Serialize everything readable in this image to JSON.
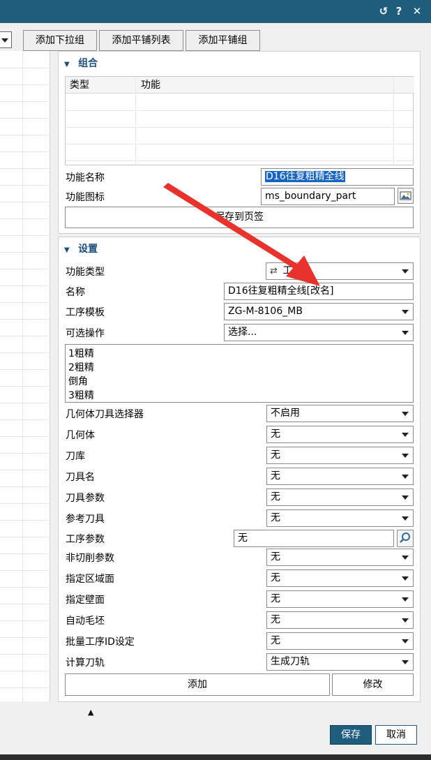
{
  "titlebar": {
    "icons": [
      "refresh-icon",
      "help-icon",
      "close-icon"
    ],
    "refresh_glyph": "↺",
    "help_glyph": "?",
    "close_glyph": "✕"
  },
  "toolbar": {
    "add_dropdown_group": "添加下拉组",
    "add_tile_list": "添加平铺列表",
    "add_tile_group": "添加平铺组"
  },
  "group_section": {
    "title": "组合",
    "table_headers": [
      "类型",
      "功能"
    ],
    "func_name_label": "功能名称",
    "func_name_value": "D16往复粗精全线",
    "func_icon_label": "功能图标",
    "func_icon_value": "ms_boundary_part",
    "save_to_tab": "保存到页签"
  },
  "settings_section": {
    "title": "设置",
    "rows": [
      {
        "label": "功能类型",
        "value": "工序",
        "icon": "operation-type-icon"
      },
      {
        "label": "名称",
        "value": "D16往复粗精全线[改名]"
      },
      {
        "label": "工序模板",
        "value": "ZG-M-8106_MB"
      },
      {
        "label": "可选操作",
        "value": "选择..."
      }
    ],
    "operations_list": [
      "1粗精",
      "2粗精",
      "倒角",
      "3粗精"
    ],
    "dropdowns": [
      {
        "label": "几何体刀具选择器",
        "value": "不启用"
      },
      {
        "label": "几何体",
        "value": "无"
      },
      {
        "label": "刀库",
        "value": "无"
      },
      {
        "label": "刀具名",
        "value": "无"
      },
      {
        "label": "刀具参数",
        "value": "无"
      },
      {
        "label": "参考刀具",
        "value": "无"
      }
    ],
    "op_param": {
      "label": "工序参数",
      "value": "无"
    },
    "dropdowns2": [
      {
        "label": "非切削参数",
        "value": "无"
      },
      {
        "label": "指定区域面",
        "value": "无"
      },
      {
        "label": "指定壁面",
        "value": "无"
      },
      {
        "label": "自动毛坯",
        "value": "无"
      },
      {
        "label": "批量工序ID设定",
        "value": "无"
      },
      {
        "label": "计算刀轨",
        "value": "生成刀轨"
      }
    ],
    "add_button": "添加",
    "modify_button": "修改"
  },
  "footer": {
    "save": "保存",
    "cancel": "取消",
    "collapse_glyph": "▲"
  },
  "colors": {
    "titlebar": "#1f5d7f",
    "section_title": "#1a4f7a",
    "selection": "#1565c0",
    "annotation_arrow": "#e8322c"
  }
}
